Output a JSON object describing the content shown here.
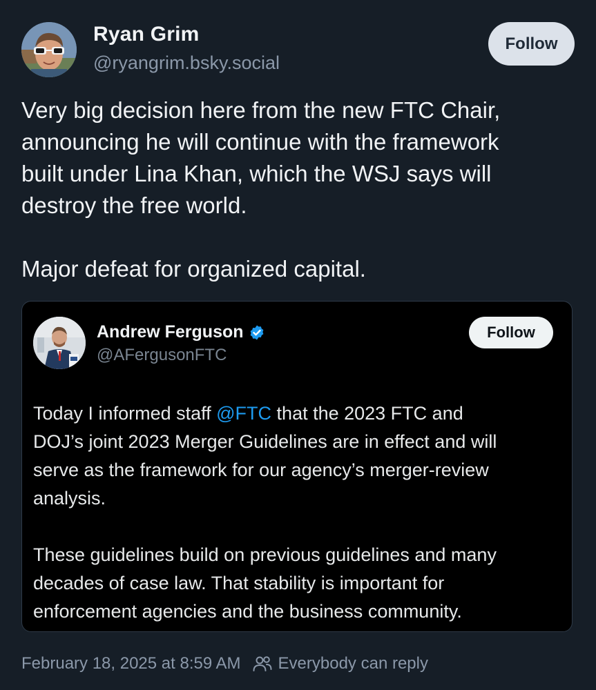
{
  "post": {
    "author_name": "Ryan Grim",
    "author_handle": "@ryangrim.bsky.social",
    "follow_label": "Follow",
    "text_lines_p1": [
      "Very big decision here from the new FTC Chair,",
      "announcing he will continue with the framework",
      "built under Lina Khan, which the WSJ says will",
      "destroy the free world."
    ],
    "text_p2": "Major defeat for organized capital.",
    "timestamp": "February 18, 2025 at 8:59 AM",
    "reply_setting": "Everybody can reply"
  },
  "quote": {
    "author_name": "Andrew Ferguson",
    "author_handle": "@AFergusonFTC",
    "follow_label": "Follow",
    "line1_before": "Today I informed staff ",
    "mention": "@FTC",
    "line1_after": " that the 2023 FTC and",
    "lines_p1_rest": [
      "DOJ’s joint 2023 Merger Guidelines are in effect and will",
      "serve as the framework for our agency’s merger-review",
      "analysis."
    ],
    "lines_p2": [
      "These guidelines build on previous guidelines and many",
      "decades of case law. That stability is important for",
      "enforcement agencies and the business community."
    ]
  },
  "icons": {
    "verified": "verified-badge-icon",
    "reply": "people-icon"
  },
  "colors": {
    "background": "#161e27",
    "quote_background": "#000000",
    "link": "#1d9bf0",
    "verified": "#1d9bf0",
    "follow_button": "#dce2ea"
  }
}
